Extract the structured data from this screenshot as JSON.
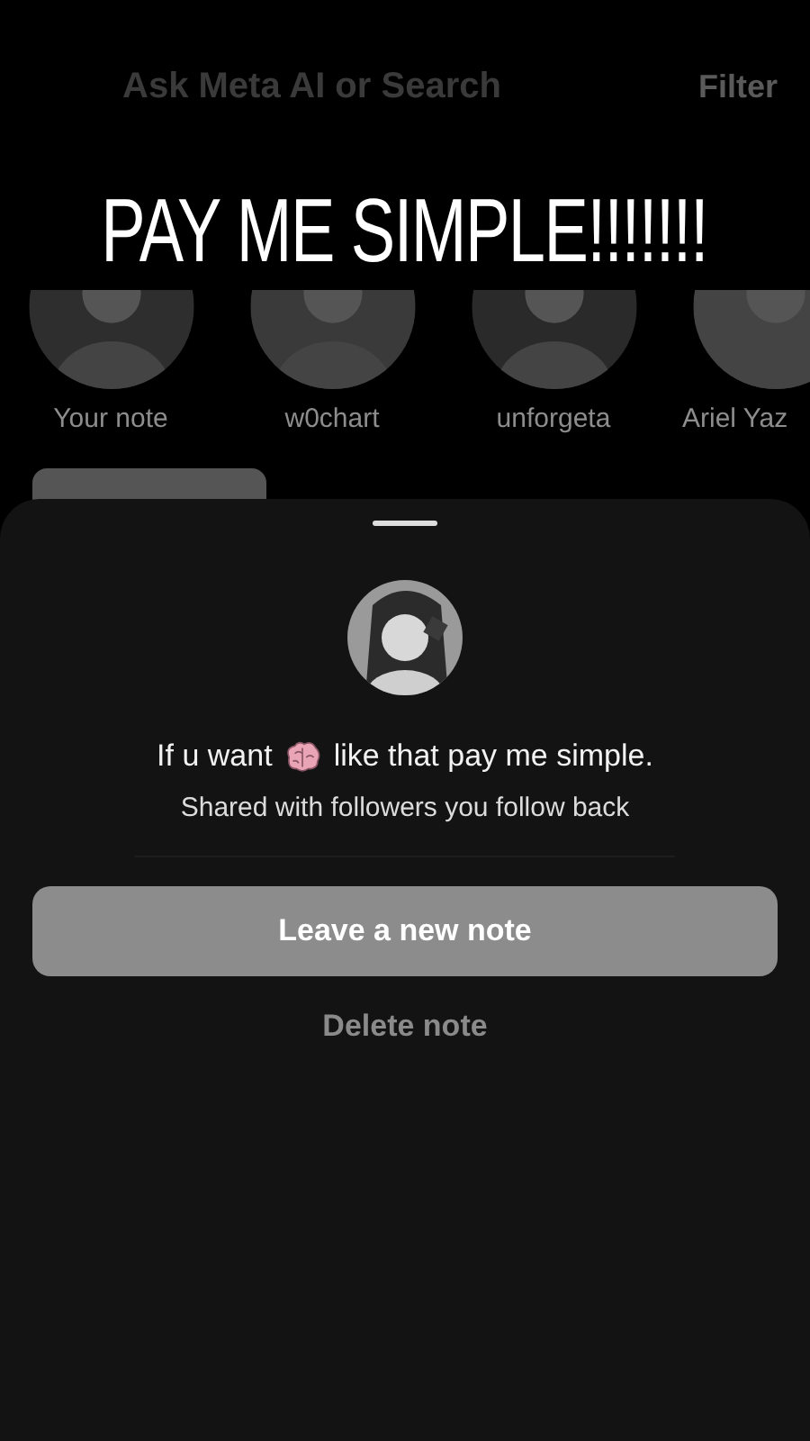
{
  "search": {
    "placeholder": "Ask Meta AI or Search"
  },
  "filter": "Filter",
  "story_caption": "PAY ME SIMPLE!!!!!!!",
  "notes": [
    {
      "name": "Your note"
    },
    {
      "name": "w0chart"
    },
    {
      "name": "unforgeta"
    },
    {
      "name": "Ariel Yaz"
    }
  ],
  "sheet": {
    "note_before": "If u want",
    "note_after": "like that pay me simple.",
    "audience": "Shared with followers you follow back",
    "primary_button": "Leave a new note",
    "secondary_button": "Delete note"
  }
}
